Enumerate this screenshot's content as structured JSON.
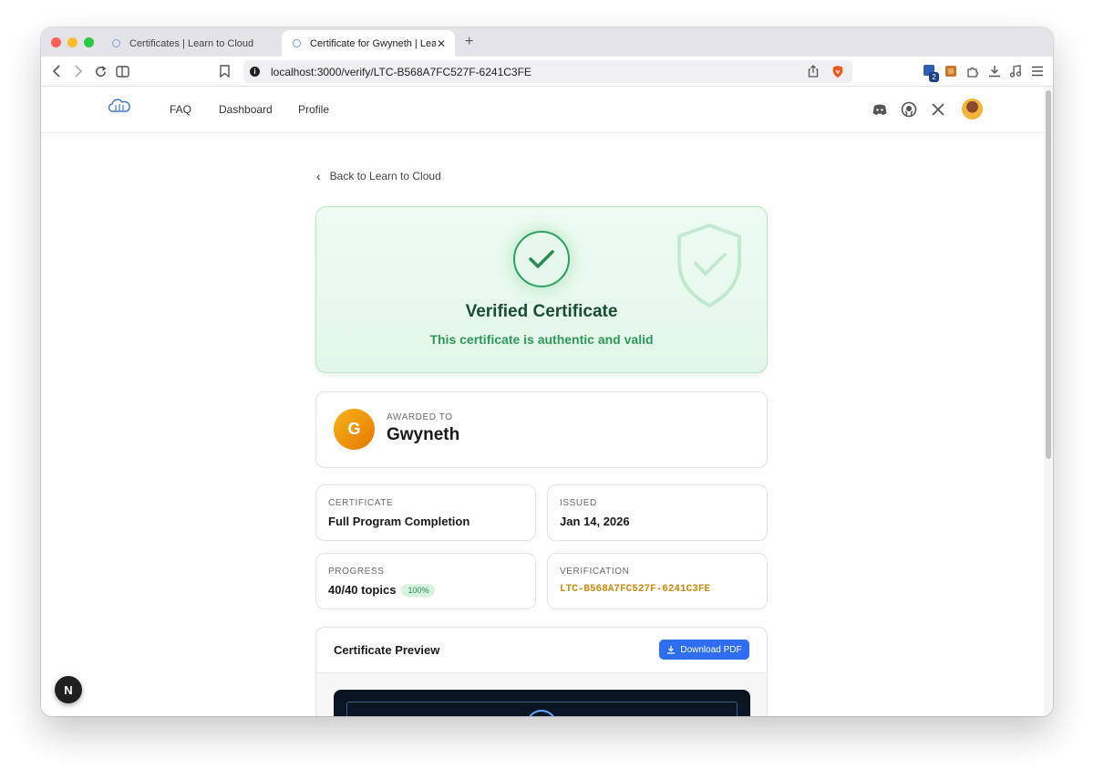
{
  "browser": {
    "tabs": [
      {
        "title": "Certificates | Learn to Cloud"
      },
      {
        "title": "Certificate for Gwyneth | Learn"
      }
    ],
    "url": "localhost:3000/verify/LTC-B568A7FC527F-6241C3FE",
    "extension_badge_count": "2",
    "new_tab_symbol": "+"
  },
  "site_nav": {
    "links": [
      "FAQ",
      "Dashboard",
      "Profile"
    ],
    "social_icons": [
      "discord-icon",
      "github-icon",
      "x-icon"
    ]
  },
  "page": {
    "back_link": "Back to Learn to Cloud",
    "hero": {
      "title": "Verified Certificate",
      "subtitle": "This certificate is authentic and valid",
      "accent_color": "#2d9a5a"
    },
    "awarded": {
      "label": "AWARDED TO",
      "initial": "G",
      "name": "Gwyneth"
    },
    "details": {
      "certificate": {
        "label": "CERTIFICATE",
        "value": "Full Program Completion"
      },
      "issued": {
        "label": "ISSUED",
        "value": "Jan 14, 2026"
      },
      "progress": {
        "label": "PROGRESS",
        "value": "40/40 topics",
        "badge": "100%"
      },
      "verification": {
        "label": "VERIFICATION",
        "value": "LTC-B568A7FC527F-6241C3FE"
      }
    },
    "preview": {
      "title": "Certificate Preview",
      "download_label": "Download PDF",
      "button_color": "#2f6ef3"
    }
  },
  "dev_overlay": {
    "label": "N"
  }
}
